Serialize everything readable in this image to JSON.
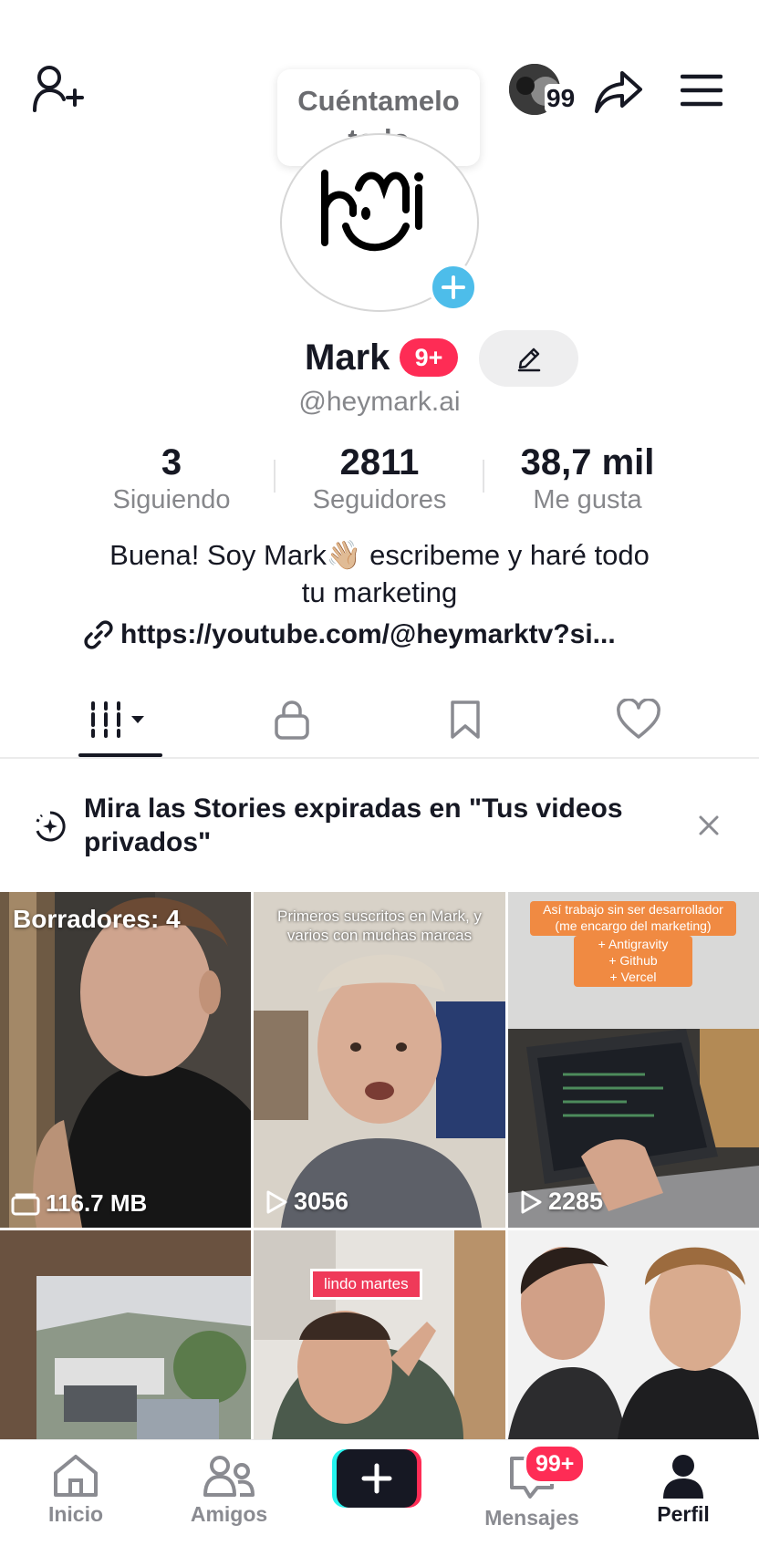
{
  "top_bar": {
    "tooltip": "Cuéntamelo todo",
    "notification_count": "99",
    "icons": [
      "add-user-icon",
      "share-icon",
      "menu-icon"
    ]
  },
  "profile": {
    "name": "Mark",
    "name_badge": "9+",
    "handle": "@heymark.ai",
    "stats": [
      {
        "value": "3",
        "label": "Siguiendo"
      },
      {
        "value": "2811",
        "label": "Seguidores"
      },
      {
        "value": "38,7 mil",
        "label": "Me gusta"
      }
    ],
    "bio_line1": "Buena! Soy Mark👋🏼 escribeme y haré todo",
    "bio_line2": "tu marketing",
    "link": "https://youtube.com/@heymarktv?si..."
  },
  "tabs": [
    {
      "icon": "grid-videos-icon",
      "active": true
    },
    {
      "icon": "lock-icon",
      "active": false
    },
    {
      "icon": "bookmark-icon",
      "active": false
    },
    {
      "icon": "heart-icon",
      "active": false
    }
  ],
  "banner": {
    "text": "Mira las Stories expiradas en \"Tus videos privados\""
  },
  "grid": {
    "tiles": [
      {
        "overlay_top": "Borradores: 4",
        "overlay_bottom": "116.7 MB"
      },
      {
        "caption": "Primeros suscritos en Mark, y varios con muchas marcas",
        "views": "3056"
      },
      {
        "caption_lines": [
          "Así trabajo sin ser desarrollador",
          "(me encargo del marketing)",
          "+ Antigravity",
          "+ Github",
          "+ Vercel"
        ],
        "views": "2285"
      },
      {},
      {
        "caption": "lindo martes"
      },
      {}
    ]
  },
  "bottom_nav": {
    "items": [
      {
        "label": "Inicio",
        "icon": "home-icon"
      },
      {
        "label": "Amigos",
        "icon": "friends-icon"
      },
      {
        "label": "",
        "icon": "create-icon"
      },
      {
        "label": "Mensajes",
        "icon": "inbox-icon",
        "badge": "99+"
      },
      {
        "label": "Perfil",
        "icon": "profile-icon",
        "active": true
      }
    ]
  },
  "colors": {
    "accent": "#fe2c55",
    "avatar_add": "#4dbdea",
    "text": "#161823",
    "muted": "#86878b"
  }
}
